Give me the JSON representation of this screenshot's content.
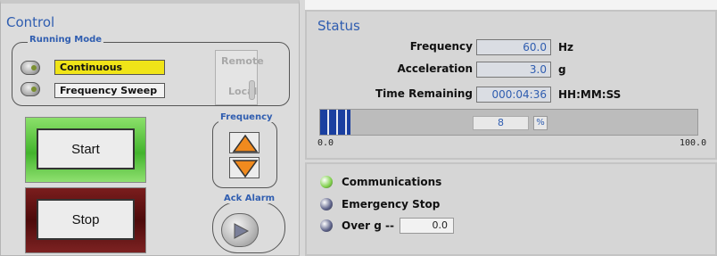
{
  "control": {
    "title": "Control",
    "running_mode": {
      "label": "Running Mode",
      "options": [
        {
          "label": "Continuous",
          "selected": true
        },
        {
          "label": "Frequency Sweep",
          "selected": false
        }
      ]
    },
    "remote_local": {
      "remote_label": "Remote",
      "local_label": "Local"
    },
    "frequency_group": {
      "label": "Frequency",
      "up_icon": "arrow-up-icon",
      "down_icon": "arrow-down-icon"
    },
    "start_label": "Start",
    "stop_label": "Stop",
    "ack_alarm_label": "Ack Alarm",
    "colors": {
      "selected_mode": "#f0e418",
      "start_frame": "#43b42d",
      "stop_frame": "#5a1010",
      "arrow_fill": "#f08a1e",
      "title_blue": "#2f5db0"
    }
  },
  "status": {
    "title": "Status",
    "frequency": {
      "label": "Frequency",
      "value": "60.0",
      "unit": "Hz"
    },
    "acceleration": {
      "label": "Acceleration",
      "value": "3.0",
      "unit": "g"
    },
    "time_remaining": {
      "label": "Time Remaining",
      "value": "000:04:36",
      "unit": "HH:MM:SS"
    },
    "progress": {
      "value": 8,
      "percent_label": "%",
      "scale_min": "0.0",
      "scale_max": "100.0"
    }
  },
  "alarms": {
    "items": [
      {
        "label": "Communications",
        "state": "on",
        "color": "#7fd04a"
      },
      {
        "label": "Emergency Stop",
        "state": "off",
        "color": "#5a5f86"
      },
      {
        "label": "Over g --",
        "state": "off",
        "color": "#5a5f86"
      }
    ],
    "over_g_value": "0.0"
  }
}
